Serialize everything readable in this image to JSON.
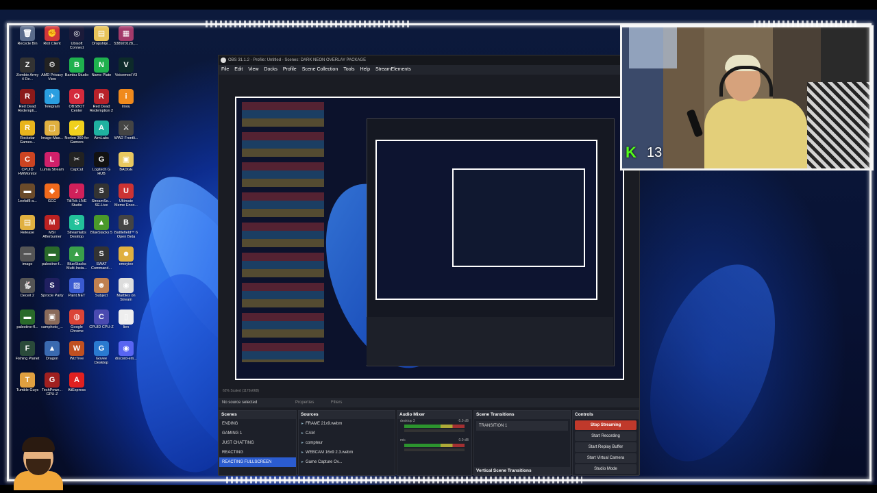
{
  "desktop": {
    "icons": [
      {
        "label": "Recycle Bin",
        "glyph": "🗑",
        "color": "#5a6b8a"
      },
      {
        "label": "Riot Client",
        "glyph": "✊",
        "color": "#d13639"
      },
      {
        "label": "Ubisoft Connect",
        "glyph": "◎",
        "color": "#1b1b3a"
      },
      {
        "label": "Dropshipi...",
        "glyph": "▤",
        "color": "#e8c35a"
      },
      {
        "label": "538920128_...",
        "glyph": "▦",
        "color": "#a33a6a"
      },
      {
        "label": "Zombie Army 4 De...",
        "glyph": "Z",
        "color": "#333"
      },
      {
        "label": "AMD Privacy View",
        "glyph": "⚙",
        "color": "#222"
      },
      {
        "label": "Bambu Studio",
        "glyph": "B",
        "color": "#1fb14e"
      },
      {
        "label": "Name Plate",
        "glyph": "N",
        "color": "#1fb14e"
      },
      {
        "label": "Voicemod V3",
        "glyph": "V",
        "color": "#0d2a2a"
      },
      {
        "label": "Red Dead Redempti...",
        "glyph": "R",
        "color": "#8b1a1a"
      },
      {
        "label": "Telegram",
        "glyph": "✈",
        "color": "#2a9ee0"
      },
      {
        "label": "OBSBOT Center",
        "glyph": "O",
        "color": "#d42a3c"
      },
      {
        "label": "Red Dead Redemption 2",
        "glyph": "R",
        "color": "#b8222a"
      },
      {
        "label": "Imou",
        "glyph": "i",
        "color": "#f08a1c"
      },
      {
        "label": "Rockstar Games...",
        "glyph": "R",
        "color": "#e8b41c"
      },
      {
        "label": "Image-Mas...",
        "glyph": "▢",
        "color": "#e0b040"
      },
      {
        "label": "Norton 360 for Gamers",
        "glyph": "✔",
        "color": "#f0d01c"
      },
      {
        "label": "AimLabs",
        "glyph": "A",
        "color": "#1fb1a0"
      },
      {
        "label": "WW2 Frontli...",
        "glyph": "⚔",
        "color": "#444"
      },
      {
        "label": "CPUID HWMonitor",
        "glyph": "C",
        "color": "#c42"
      },
      {
        "label": "Lumia Stream",
        "glyph": "L",
        "color": "#d0206a"
      },
      {
        "label": "CapCut",
        "glyph": "✂",
        "color": "#222"
      },
      {
        "label": "Logitech G HUB",
        "glyph": "G",
        "color": "#111"
      },
      {
        "label": "BADGE",
        "glyph": "▣",
        "color": "#e8c860"
      },
      {
        "label": "1eefaf8-a...",
        "glyph": "▬",
        "color": "#6a4a2a"
      },
      {
        "label": "GCC",
        "glyph": "◆",
        "color": "#f06a1c"
      },
      {
        "label": "TikTok LIVE Studio",
        "glyph": "♪",
        "color": "#d0205a"
      },
      {
        "label": "StreamSe... SE.Live",
        "glyph": "S",
        "color": "#333"
      },
      {
        "label": "Ultimate Meme Enco...",
        "glyph": "U",
        "color": "#c33"
      },
      {
        "label": "Release",
        "glyph": "▤",
        "color": "#e0b040"
      },
      {
        "label": "MSI Afterburner",
        "glyph": "M",
        "color": "#b22"
      },
      {
        "label": "Streamlabs Desktop",
        "glyph": "S",
        "color": "#23c19a"
      },
      {
        "label": "BlueStacks 5",
        "glyph": "▲",
        "color": "#4a9a2a"
      },
      {
        "label": "Battlefield™ 6 Open Beta",
        "glyph": "B",
        "color": "#444"
      },
      {
        "label": "image",
        "glyph": "—",
        "color": "#555"
      },
      {
        "label": "palestine-f...",
        "glyph": "▬",
        "color": "#2a6a2a"
      },
      {
        "label": "BlueStacks Multi-Insta...",
        "glyph": "▲",
        "color": "#3aa04a"
      },
      {
        "label": "SWAT Command...",
        "glyph": "S",
        "color": "#333"
      },
      {
        "label": "emoyiee",
        "glyph": "☻",
        "color": "#e0b040"
      },
      {
        "label": "Deceit 2",
        "glyph": "🐇",
        "color": "#555"
      },
      {
        "label": "Sprocle Party",
        "glyph": "S",
        "color": "#202060"
      },
      {
        "label": "Paint.NET",
        "glyph": "▨",
        "color": "#3a5ad0"
      },
      {
        "label": "Subject",
        "glyph": "☻",
        "color": "#c08050"
      },
      {
        "label": "Marbles on Stream",
        "glyph": "◉",
        "color": "#ddd"
      },
      {
        "label": "palestine-fl...",
        "glyph": "▬",
        "color": "#2a6a2a"
      },
      {
        "label": "camphoto_...",
        "glyph": "▣",
        "color": "#8a6a5a"
      },
      {
        "label": "Google Chrome",
        "glyph": "◍",
        "color": "#db4437"
      },
      {
        "label": "CPUID CPU-Z",
        "glyph": "C",
        "color": "#4a4ab0"
      },
      {
        "label": "lien",
        "glyph": "▯",
        "color": "#eee"
      },
      {
        "label": "Fishing Planet",
        "glyph": "F",
        "color": "#2a4a3a"
      },
      {
        "label": "Dragon",
        "glyph": "▲",
        "color": "#3a6ab0"
      },
      {
        "label": "WizTree",
        "glyph": "W",
        "color": "#c05020"
      },
      {
        "label": "Govee Desktop",
        "glyph": "G",
        "color": "#2a7ad0"
      },
      {
        "label": "discord-em...",
        "glyph": "◉",
        "color": "#5865f2"
      },
      {
        "label": "Tumble Guys",
        "glyph": "T",
        "color": "#e0a040"
      },
      {
        "label": "TechPowe... GPU-Z",
        "glyph": "G",
        "color": "#a02020"
      },
      {
        "label": "AliExpress",
        "glyph": "A",
        "color": "#e02020"
      }
    ]
  },
  "obs": {
    "title": "OBS 31.1.2 - Profile: Untitled - Scenes: DARK NEON OVERLAY PACKAGE",
    "menu": [
      "File",
      "Edit",
      "View",
      "Docks",
      "Profile",
      "Scene Collection",
      "Tools",
      "Help",
      "StreamElements"
    ],
    "status": "62%   Scaled (1179x668)",
    "no_source": "No source selected",
    "properties_label": "Properties",
    "filters_label": "Filters",
    "docks": {
      "scenes": {
        "title": "Scenes",
        "items": [
          "ENDING",
          "GAMING 1",
          "JUST CHATTING",
          "REACTING",
          "REACTING FULLSCREEN"
        ],
        "selected": 4
      },
      "sources": {
        "title": "Sources",
        "items": [
          "FRAME 21x9.webm",
          "CAM",
          "compteur",
          "WEBCAM 16x9 2.3.webm",
          "Game Capture Ov..."
        ]
      },
      "mixer": {
        "title": "Audio Mixer",
        "channels": [
          {
            "name": "desktop 3",
            "db": "-5.0 dB"
          },
          {
            "name": "mic",
            "db": "0.0 dB"
          }
        ]
      },
      "transitions": {
        "title": "Scene Transitions",
        "value": "TRANSITION 1",
        "vertical_title": "Vertical Scene Transitions"
      },
      "controls": {
        "title": "Controls",
        "buttons": [
          "Stop Streaming",
          "Start Recording",
          "Start Replay Buffer",
          "Start Virtual Camera",
          "Studio Mode"
        ]
      }
    }
  },
  "webcam": {
    "platform": "K",
    "viewer_count": "13"
  },
  "colors": {
    "accent": "#2b5ccf",
    "stop": "#c0392b",
    "kick": "#53fc18",
    "frame": "#f4f4f4"
  }
}
